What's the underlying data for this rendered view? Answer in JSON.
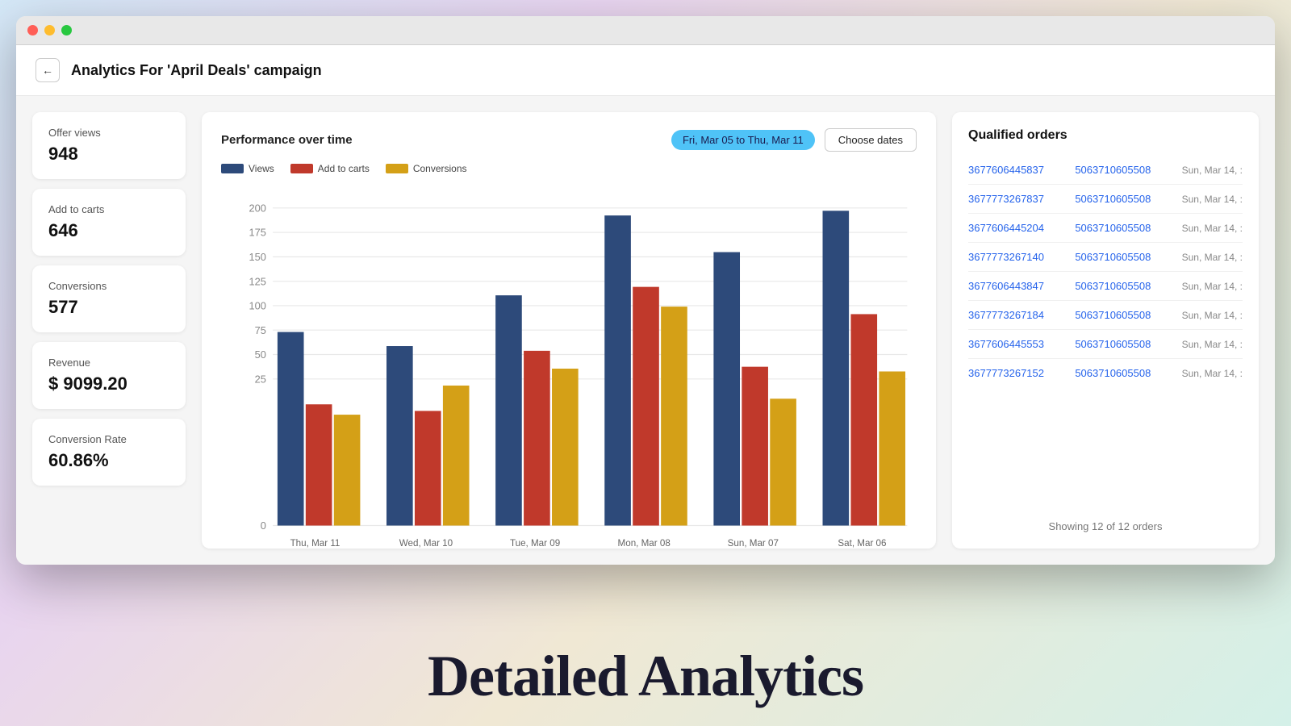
{
  "window": {
    "title": "Analytics For 'April Deals' campaign"
  },
  "header": {
    "back_label": "←",
    "title": "Analytics For 'April Deals' campaign"
  },
  "stats": [
    {
      "label": "Offer views",
      "value": "948"
    },
    {
      "label": "Add to carts",
      "value": "646"
    },
    {
      "label": "Conversions",
      "value": "577"
    },
    {
      "label": "Revenue",
      "value": "$ 9099.20"
    },
    {
      "label": "Conversion Rate",
      "value": "60.86%"
    }
  ],
  "chart": {
    "title": "Performance over time",
    "date_range": "Fri, Mar 05 to Thu, Mar 11",
    "choose_dates_label": "Choose dates",
    "legend": [
      {
        "label": "Views",
        "color": "#2d4a7a"
      },
      {
        "label": "Add to carts",
        "color": "#c0392b"
      },
      {
        "label": "Conversions",
        "color": "#d4a017"
      }
    ],
    "y_labels": [
      "200",
      "175",
      "150",
      "125",
      "100",
      "75",
      "50",
      "25",
      "0"
    ],
    "days": [
      {
        "label": "Thu, Mar 11",
        "views": 122,
        "add_to_carts": 76,
        "conversions": 70
      },
      {
        "label": "Wed, Mar 10",
        "views": 113,
        "add_to_carts": 72,
        "conversions": 88
      },
      {
        "label": "Tue, Mar 09",
        "views": 145,
        "add_to_carts": 110,
        "conversions": 99
      },
      {
        "label": "Mon, Mar 08",
        "views": 195,
        "add_to_carts": 150,
        "conversions": 138
      },
      {
        "label": "Sun, Mar 07",
        "views": 172,
        "add_to_carts": 100,
        "conversions": 80
      },
      {
        "label": "Sat, Mar 06",
        "views": 198,
        "add_to_carts": 133,
        "conversions": 97
      }
    ],
    "max_value": 210
  },
  "orders": {
    "title": "Qualified orders",
    "rows": [
      {
        "order_id": "3677606445837",
        "product_id": "5063710605508",
        "date": "Sun, Mar 14, :"
      },
      {
        "order_id": "3677773267837",
        "product_id": "5063710605508",
        "date": "Sun, Mar 14, :"
      },
      {
        "order_id": "3677606445204",
        "product_id": "5063710605508",
        "date": "Sun, Mar 14, :"
      },
      {
        "order_id": "3677773267140",
        "product_id": "5063710605508",
        "date": "Sun, Mar 14, :"
      },
      {
        "order_id": "3677606443847",
        "product_id": "5063710605508",
        "date": "Sun, Mar 14, :"
      },
      {
        "order_id": "3677773267184",
        "product_id": "5063710605508",
        "date": "Sun, Mar 14, :"
      },
      {
        "order_id": "3677606445553",
        "product_id": "5063710605508",
        "date": "Sun, Mar 14, :"
      },
      {
        "order_id": "3677773267152",
        "product_id": "5063710605508",
        "date": "Sun, Mar 14, :"
      }
    ],
    "footer": "Showing 12 of 12 orders"
  },
  "bottom_text": "Detailed Analytics"
}
